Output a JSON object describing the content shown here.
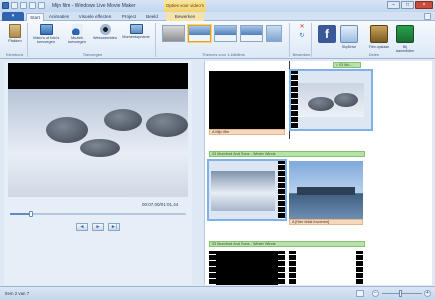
{
  "window": {
    "title": "Mijn film - Windows Live Movie Maker",
    "context_header": "Opties voor video's",
    "minimize": "–",
    "maximize": "□",
    "close": "×"
  },
  "ribbon_tabs": {
    "file": "▾",
    "items": [
      "Start",
      "Animaties",
      "Visuele effecten",
      "Project",
      "Beeld",
      "Bewerken"
    ],
    "active": "Start"
  },
  "groups": {
    "clipboard": {
      "label": "Klembord",
      "paste": "Plakken"
    },
    "add": {
      "label": "Toevoegen",
      "buttons": [
        "Video's of foto's toevoegen",
        "Muziek toevoegen",
        "Webcamvideo",
        "Momentopname"
      ]
    },
    "themes": {
      "label": "Thema's voor 1-klikfilms"
    },
    "editing": {
      "label": "Bewerken"
    },
    "share": {
      "label": "Delen",
      "skydrive": "SkyDrive",
      "save": "Film opslaan",
      "signin": "Bij Aanmelden"
    }
  },
  "player": {
    "timecode": "00:07,00/01:01,44",
    "progress_fraction": 0.12,
    "prev": "◄",
    "play": "►",
    "next": "►|"
  },
  "storyboard": {
    "top_music": "♪ 03 Mu...",
    "caption1": "A Mijn film",
    "music_row2": "03 Mumford And Sons - Winter Winds",
    "caption2": "A [Hier tekst invoeren]",
    "music_row3": "03 Mumford And Sons - Winter Winds"
  },
  "status": {
    "text": "Item 2 van 7",
    "zoom_out": "−",
    "zoom_in": "+",
    "zoom_fraction": 0.45
  },
  "colors": {
    "accent": "#2f65b0",
    "selection": "#7eb1ea",
    "music": "#b9e2a8",
    "caption": "#f6d9bd"
  }
}
